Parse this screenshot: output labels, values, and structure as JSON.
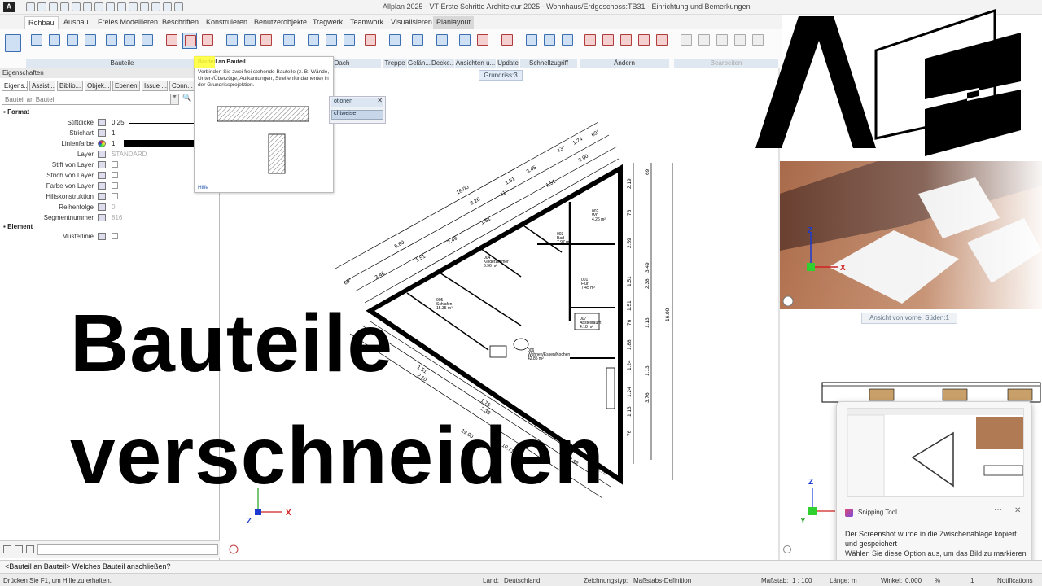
{
  "window": {
    "title": "Allplan 2025 - VT-Erste Schritte Architektur 2025 - Wohnhaus/Erdgeschoss:TB31 - Einrichtung und Bemerkungen",
    "logo": "A"
  },
  "tabs": [
    "Rohbau",
    "Ausbau",
    "Freies Modellieren",
    "Beschriften",
    "Konstruieren",
    "Benutzerobjekte",
    "Tragwerk",
    "Teamwork",
    "Visualisieren",
    "Planlayout"
  ],
  "ribbon_groups": [
    "Bauteile",
    "Dach",
    "Treppe",
    "Gelän...",
    "Decke...",
    "Ansichten u...",
    "Update",
    "Schnellzugriff",
    "Ändern",
    "Bearbeiten"
  ],
  "tooltip": {
    "title": "Bauteil an Bauteil",
    "body": "Verbinden Sie zwei frei stehende Bauteile (z. B. Wände, Unter-/Überzüge, Aufkantungen, Streifenfundamente) in der Grundrissprojektion.",
    "help": "Hilfe"
  },
  "float_dialog": {
    "title": "otionen",
    "button": "chtweise"
  },
  "panel": {
    "header": "Eigenschaften",
    "tabs": [
      "Eigens...",
      "Assist...",
      "Biblio...",
      "Objek...",
      "Ebenen",
      "Issue ...",
      "Conn..."
    ],
    "combo": "Bauteil an Bauteil",
    "sections": {
      "format": "Format",
      "element": "Element"
    },
    "rows": [
      {
        "label": "Stiftdicke",
        "value": "0.25"
      },
      {
        "label": "Strichart",
        "value": "1"
      },
      {
        "label": "Linienfarbe",
        "value": "1"
      },
      {
        "label": "Layer",
        "value": "STANDARD"
      },
      {
        "label": "Stift von Layer",
        "value": ""
      },
      {
        "label": "Strich von Layer",
        "value": ""
      },
      {
        "label": "Farbe von Layer",
        "value": ""
      },
      {
        "label": "Hilfskonstruktion",
        "value": ""
      },
      {
        "label": "Reihenfolge",
        "value": "0"
      },
      {
        "label": "Segmentnummer",
        "value": "816"
      }
    ],
    "element_row": {
      "label": "Musterlinie"
    }
  },
  "viewports": {
    "grundriss_label": "Grundriss:3",
    "ansicht_label": "Ansicht von vorne, Süden:1",
    "axes": {
      "x": "X",
      "y": "Y",
      "z": "Z"
    }
  },
  "plan": {
    "rooms": [
      {
        "num": "001",
        "name": "Flur",
        "area": "7.45 m²"
      },
      {
        "num": "002",
        "name": "WC",
        "area": "4.26 m²"
      },
      {
        "num": "003",
        "name": "Bad",
        "area": "7.97 m²"
      },
      {
        "num": "004",
        "name": "Kinderzimmer",
        "area": "6.96 m²"
      },
      {
        "num": "005",
        "name": "Schlafen",
        "area": "15.35 m²"
      },
      {
        "num": "006",
        "name": "Wohnen/Essen/Kochen",
        "area": "42.85 m²"
      },
      {
        "num": "007",
        "name": "Abstellraum",
        "area": "4.18 m²"
      }
    ],
    "dims_top": [
      "16.00",
      "5.80",
      "3.26",
      "1.51",
      "3.45",
      "1.51",
      "3.00",
      "13°",
      "1.74",
      "69°",
      "3.46",
      "1.51",
      "2.49",
      "1.51",
      "69°",
      "63°",
      "11°"
    ],
    "dims_right": [
      "16.00",
      "3.49",
      "2.59",
      "1.51",
      "2.38",
      "1.51",
      "1.13",
      "1.88",
      "1.24",
      "3.76",
      "1.13",
      "1.13",
      "1.24",
      "2.19",
      "76",
      "76",
      "76",
      "69"
    ],
    "dims_bottom": [
      "19.00",
      "10.71",
      "1.76",
      "2.38",
      "1.51",
      "2.10",
      "3.76",
      "2.38"
    ]
  },
  "overlay": {
    "line1": "Bauteile",
    "line2": "verschneiden"
  },
  "snip": {
    "app": "Snipping Tool",
    "dots": "···",
    "close": "✕",
    "msg1": "Der Screenshot wurde in die Zwischenablage kopiert und gespeichert",
    "msg2": "Wählen Sie diese Option aus, um das Bild zu markieren und freizugeben"
  },
  "command": "<Bauteil an Bauteil> Welches Bauteil anschließen?",
  "status": {
    "help": "Drücken Sie F1, um Hilfe zu erhalten.",
    "land_label": "Land:",
    "land": "Deutschland",
    "typ_label": "Zeichnungstyp:",
    "typ": "Maßstabs-Definition",
    "massstab_label": "Maßstab:",
    "massstab": "1 : 100",
    "laenge_label": "Länge:",
    "laenge": "m",
    "winkel_label": "Winkel:",
    "winkel": "0.000",
    "winkel_unit": "%",
    "winkel_val2": "1",
    "notifications": "Notifications"
  },
  "colors": {
    "accent": "#2a5db0",
    "highlight": "#ffff30",
    "axis_x": "#d02020",
    "axis_y": "#20a020",
    "axis_z": "#1a3ad0"
  }
}
